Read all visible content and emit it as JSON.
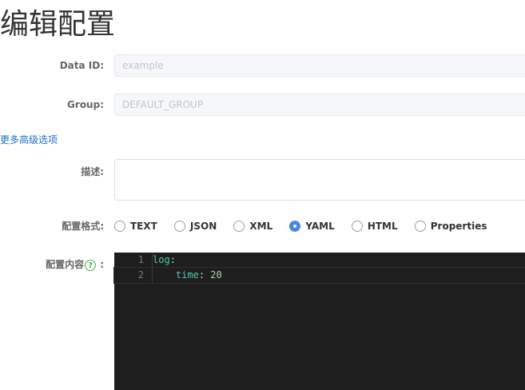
{
  "page": {
    "title": "编辑配置"
  },
  "form": {
    "data_id": {
      "label": "Data ID:",
      "placeholder": "example"
    },
    "group": {
      "label": "Group:",
      "placeholder": "DEFAULT_GROUP"
    },
    "advanced_link": "更多高级选项",
    "description": {
      "label": "描述:",
      "value": ""
    },
    "format": {
      "label": "配置格式:",
      "selected": "YAML",
      "options": [
        "TEXT",
        "JSON",
        "XML",
        "YAML",
        "HTML",
        "Properties"
      ]
    },
    "content": {
      "label_text": "配置内容",
      "help_glyph": "?",
      "label_suffix": ":"
    }
  },
  "editor": {
    "lines": [
      {
        "number": "1",
        "key": "log",
        "sep": ":",
        "value": "",
        "indent": ""
      },
      {
        "number": "2",
        "key": "time",
        "sep": ": ",
        "value": "20",
        "indent": "    "
      }
    ]
  },
  "colors": {
    "accent": "#4a86e8",
    "link": "#1a6fc4",
    "editor_bg": "#1e1e1e",
    "yaml_key": "#4ec9b0",
    "yaml_number": "#b5cea8",
    "help_icon": "#4caf50"
  }
}
